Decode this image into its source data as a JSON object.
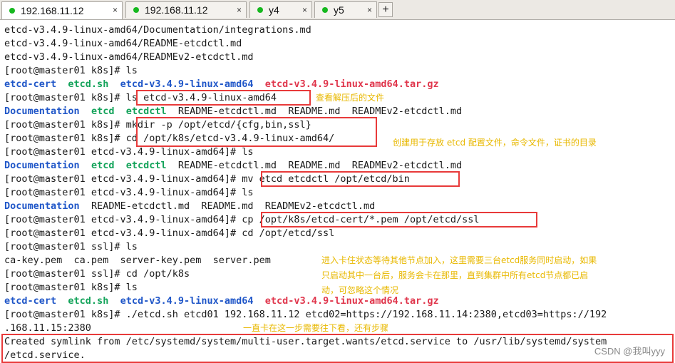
{
  "tabs": [
    {
      "label": "192.168.11.12",
      "active": true
    },
    {
      "label": "192.168.11.12",
      "active": false
    },
    {
      "label": "y4",
      "active": false
    },
    {
      "label": "y5",
      "active": false
    }
  ],
  "tab_close_glyph": "×",
  "new_tab_label": "+",
  "terminal": {
    "lines": [
      "etcd-v3.4.9-linux-amd64/Documentation/integrations.md",
      "etcd-v3.4.9-linux-amd64/README-etcdctl.md",
      "etcd-v3.4.9-linux-amd64/READMEv2-etcdctl.md",
      "[root@master01 k8s]# ls",
      "[root@master01 k8s]# ls etcd-v3.4.9-linux-amd64",
      "[root@master01 k8s]# mkdir -p /opt/etcd/{cfg,bin,ssl}",
      "[root@master01 k8s]# cd /opt/k8s/etcd-v3.4.9-linux-amd64/",
      "[root@master01 etcd-v3.4.9-linux-amd64]# ls",
      "[root@master01 etcd-v3.4.9-linux-amd64]# mv etcd etcdctl /opt/etcd/bin",
      "[root@master01 etcd-v3.4.9-linux-amd64]# ls",
      "[root@master01 etcd-v3.4.9-linux-amd64]# cp /opt/k8s/etcd-cert/*.pem /opt/etcd/ssl",
      "[root@master01 etcd-v3.4.9-linux-amd64]# cd /opt/etcd/ssl",
      "[root@master01 ssl]# ls",
      "ca-key.pem  ca.pem  server-key.pem  server.pem",
      "[root@master01 ssl]# cd /opt/k8s",
      "[root@master01 k8s]# ls",
      "[root@master01 k8s]# ./etcd.sh etcd01 192.168.11.12 etcd02=https://192.168.11.14:2380,etcd03=https://192",
      ".168.11.15:2380",
      "Created symlink from /etc/systemd/system/multi-user.target.wants/etcd.service to /usr/lib/systemd/system",
      "/etcd.service."
    ],
    "listing_k8s": {
      "dir": "etcd-cert",
      "script": "etcd.sh",
      "extracted": "etcd-v3.4.9-linux-amd64",
      "archive": "etcd-v3.4.9-linux-amd64.tar.gz"
    },
    "listing_etcd_full": {
      "doc": "Documentation",
      "bin1": "etcd",
      "bin2": "etcdctl",
      "files": "README-etcdctl.md  README.md  READMEv2-etcdctl.md"
    },
    "listing_etcd_moved": {
      "doc": "Documentation",
      "files": "README-etcdctl.md  README.md  READMEv2-etcdctl.md"
    }
  },
  "annotations": {
    "view_extracted": "查看解压后的文件",
    "create_dirs": "创建用于存放 etcd 配置文件，命令文件，证书的目录",
    "stuck_note_1": "进入卡住状态等待其他节点加入，这里需要三台etcd服务同时启动，如果",
    "stuck_note_2": "只启动其中一台后，服务会卡在那里，直到集群中所有etcd节点都已启",
    "stuck_note_3": "动，可忽略这个情况",
    "keep_going": "一直卡在这一步需要往下看，还有步骤"
  },
  "watermark": "CSDN @我叫yyy",
  "colors": {
    "dir": "#1f56c8",
    "exec": "#13a35a",
    "archive": "#e0364c",
    "highlight": "#e83a3a",
    "note": "#e8b800"
  }
}
